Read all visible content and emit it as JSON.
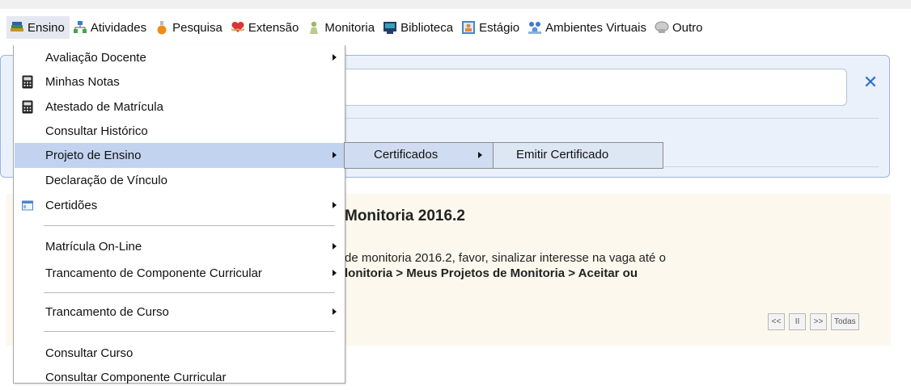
{
  "menubar": {
    "items": [
      {
        "label": "Ensino",
        "icon": "books-icon"
      },
      {
        "label": "Atividades",
        "icon": "activities-icon"
      },
      {
        "label": "Pesquisa",
        "icon": "flask-icon"
      },
      {
        "label": "Extensão",
        "icon": "heart-hands-icon"
      },
      {
        "label": "Monitoria",
        "icon": "person-icon"
      },
      {
        "label": "Biblioteca",
        "icon": "monitor-icon"
      },
      {
        "label": "Estágio",
        "icon": "id-card-icon"
      },
      {
        "label": "Ambientes Virtuais",
        "icon": "network-icon"
      },
      {
        "label": "Outro",
        "icon": "chat-icon"
      }
    ]
  },
  "dropdown": {
    "items": [
      {
        "label": "Avaliação Docente",
        "has_submenu": true
      },
      {
        "label": "Minhas Notas",
        "icon": "calculator-icon"
      },
      {
        "label": "Atestado de Matrícula",
        "icon": "calculator-icon"
      },
      {
        "label": "Consultar Histórico"
      },
      {
        "label": "Projeto de Ensino",
        "has_submenu": true,
        "highlighted": true
      },
      {
        "label": "Declaração de Vínculo"
      },
      {
        "label": "Certidões",
        "has_submenu": true,
        "icon": "window-icon"
      },
      {
        "label": "Matrícula On-Line",
        "has_submenu": true
      },
      {
        "label": "Trancamento de Componente Curricular",
        "has_submenu": true
      },
      {
        "label": "Trancamento de Curso",
        "has_submenu": true
      },
      {
        "label": "Consultar Curso"
      },
      {
        "label": "Consultar Componente Curricular"
      }
    ]
  },
  "submenu": {
    "certificados": "Certificados",
    "emitir": "Emitir Certificado"
  },
  "notice": {
    "title": "Monitoria 2016.2",
    "line1": "de monitoria 2016.2, favor, sinalizar interesse na vaga até o",
    "line2": "lonitoria > Meus Projetos de Monitoria > Aceitar ou"
  },
  "pager": {
    "prev": "<<",
    "pause": "II",
    "next": ">>",
    "all": "Todas"
  },
  "search": {
    "close": "✕"
  },
  "colors": {
    "accent": "#2a6ed6",
    "menu_hover": "#c2d3f0",
    "panel_bg": "#eaf1fb",
    "notice_bg": "#fcf8ee"
  }
}
